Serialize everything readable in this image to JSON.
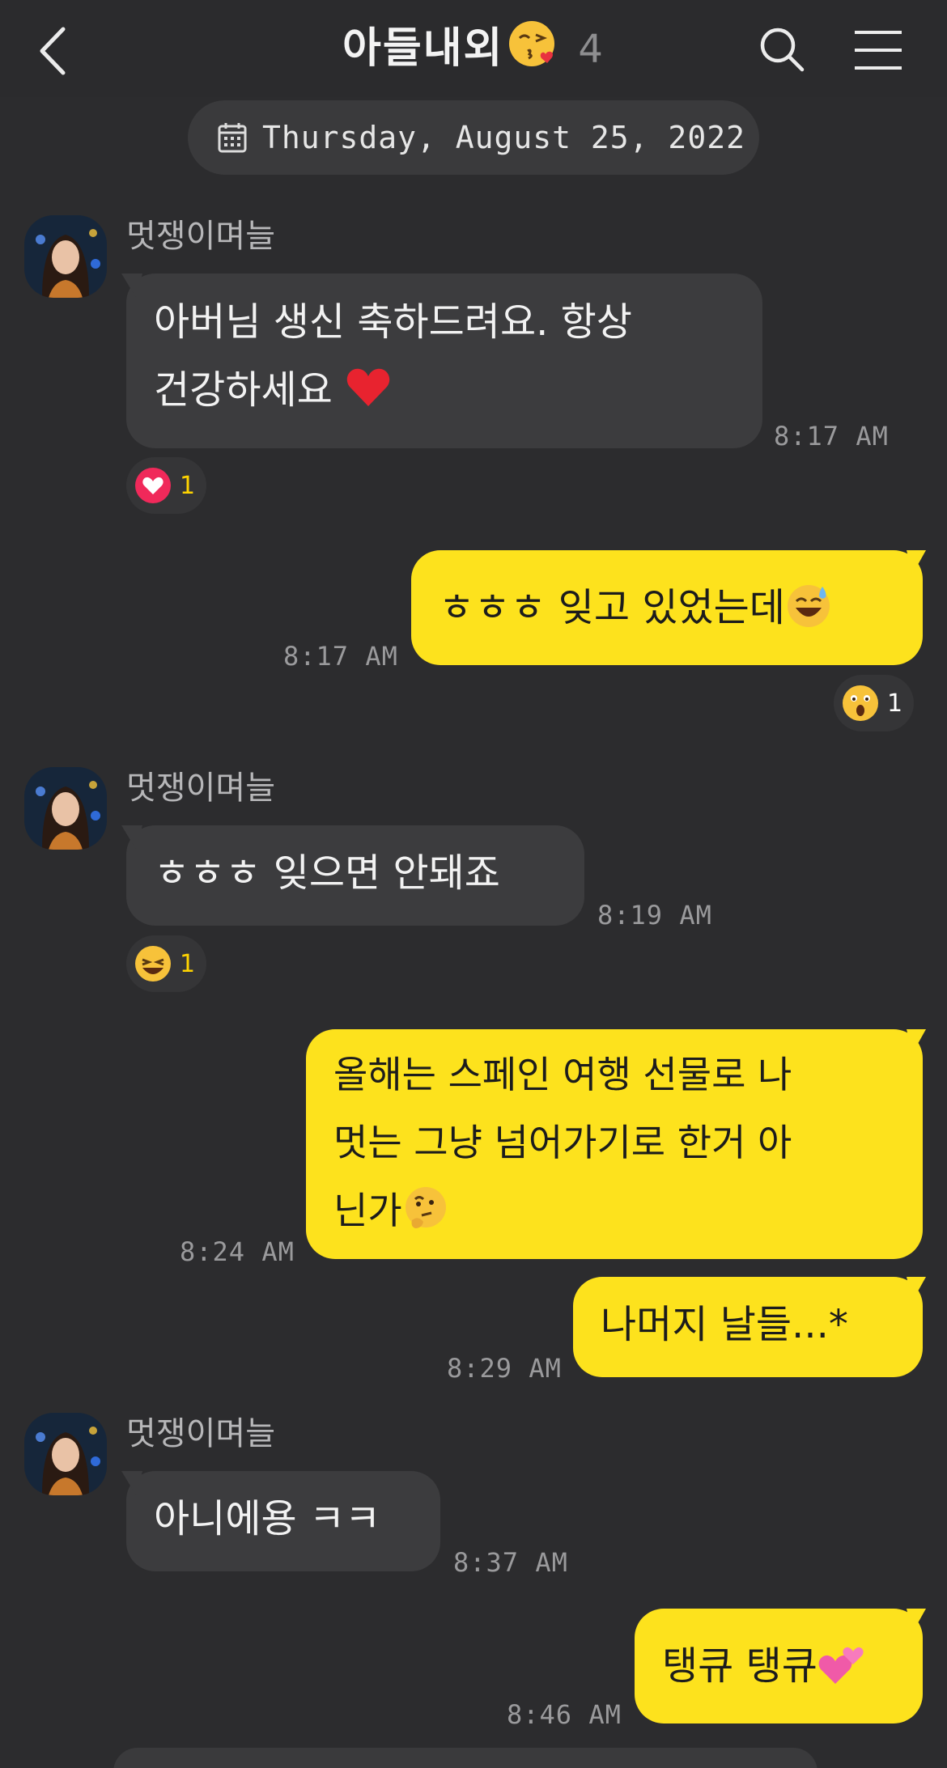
{
  "header": {
    "title": "아들내외",
    "member_count": "4"
  },
  "date_separator": "Thursday, August 25, 2022",
  "messages": [
    {
      "sender": "멋쟁이며늘",
      "direction": "in",
      "lines": [
        "아버님 생신 축하드려요. 항상",
        "건강하세요"
      ],
      "emoji": "heart",
      "time": "8:17 AM",
      "reaction": {
        "type": "heart",
        "count": "1"
      }
    },
    {
      "direction": "out",
      "lines": [
        "ㅎㅎㅎ 잊고 있었는데"
      ],
      "emoji": "sweat-smile",
      "time": "8:17 AM",
      "reaction": {
        "type": "surprised",
        "count": "1"
      }
    },
    {
      "sender": "멋쟁이며늘",
      "direction": "in",
      "lines": [
        "ㅎㅎㅎ 잊으면 안돼죠"
      ],
      "time": "8:19 AM",
      "reaction": {
        "type": "laugh",
        "count": "1"
      }
    },
    {
      "direction": "out",
      "lines": [
        "올해는 스페인 여행 선물로 나",
        "멋는 그냥 넘어가기로 한거 아",
        "닌가"
      ],
      "emoji": "thinking",
      "time": "8:24 AM"
    },
    {
      "direction": "out",
      "lines": [
        "나머지 날들...*"
      ],
      "time": "8:29 AM"
    },
    {
      "sender": "멋쟁이며늘",
      "direction": "in",
      "lines": [
        "아니에용 ㅋㅋ"
      ],
      "time": "8:37 AM"
    },
    {
      "direction": "out",
      "lines": [
        "탱큐 탱큐"
      ],
      "emoji": "two-hearts",
      "time": "8:46 AM"
    }
  ],
  "colors": {
    "background": "#2c2c2e",
    "incoming_bubble": "#3c3c3e",
    "outgoing_bubble": "#fde21d",
    "reaction_count": "#ffd400"
  }
}
